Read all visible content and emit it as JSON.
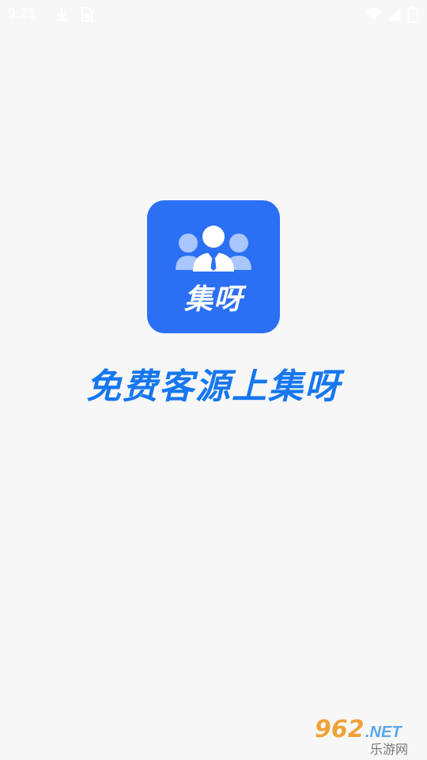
{
  "status_bar": {
    "time": "9:21",
    "icons": [
      "download-icon",
      "sim-card-icon",
      "wifi-icon",
      "signal-icon",
      "battery-icon"
    ]
  },
  "splash": {
    "logo_text": "集呀",
    "slogan": "免费客源上集呀"
  },
  "watermark": {
    "number": "962",
    "suffix": ".NET",
    "site_name": "乐游网"
  },
  "colors": {
    "background": "#f7f7f8",
    "logo_bg": "#2b6ff4",
    "slogan": "#1677f0",
    "watermark_number": "#f0a23a",
    "watermark_net": "#5aa7e6"
  }
}
